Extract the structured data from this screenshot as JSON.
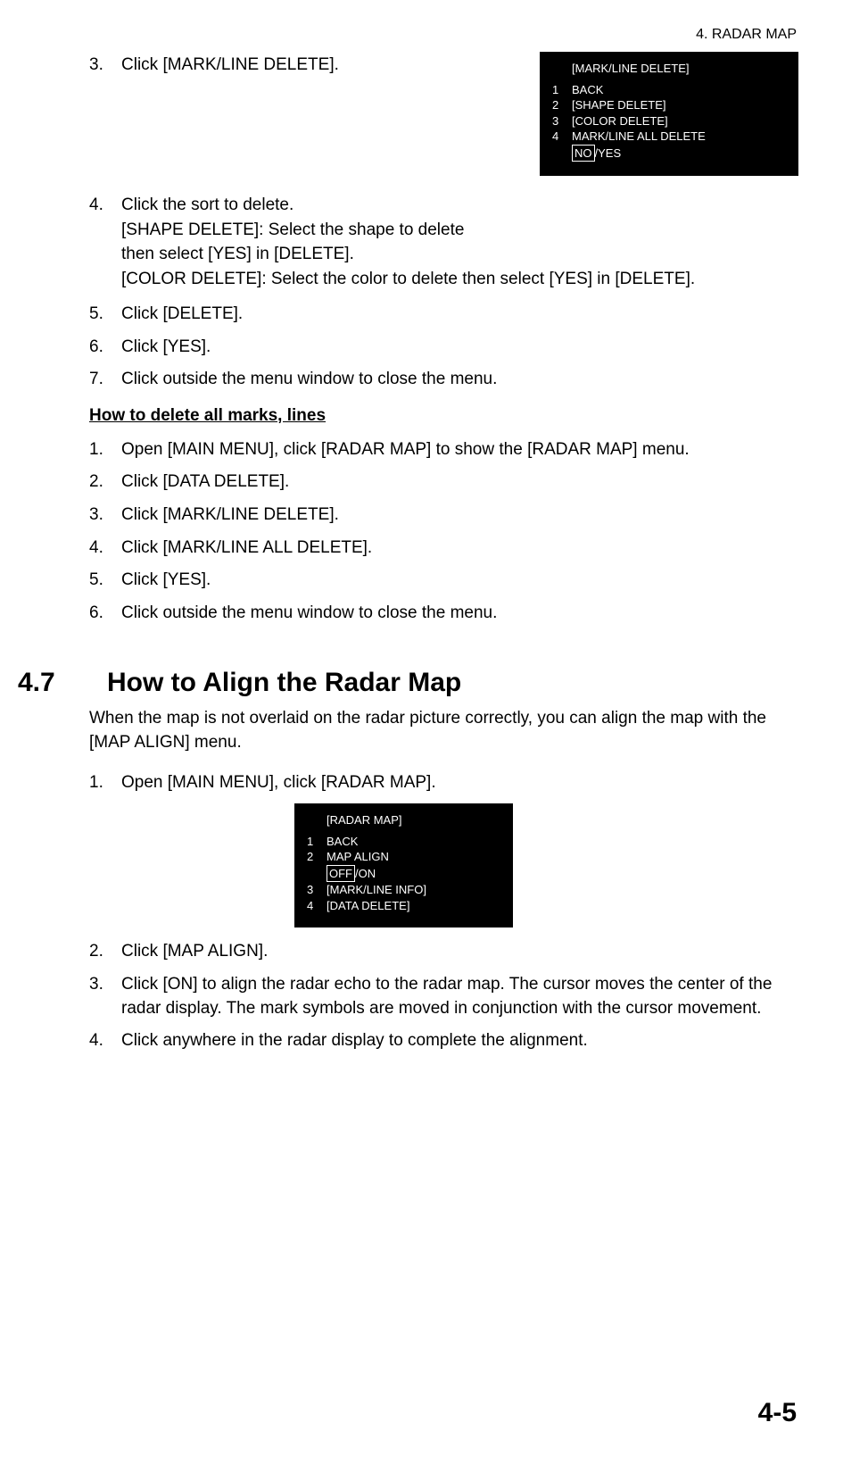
{
  "header": {
    "right": "4.  RADAR MAP"
  },
  "topSteps": {
    "s3": {
      "num": "3.",
      "text": "Click [MARK/LINE DELETE]."
    },
    "s4": {
      "num": "4.",
      "line1": "Click the sort to delete.",
      "line2": "[SHAPE DELETE]: Select the shape to delete then select [YES] in [DELETE].",
      "line3": "[COLOR DELETE]: Select the color to delete then select [YES] in [DELETE]."
    },
    "s5": {
      "num": "5.",
      "text": "Click [DELETE]."
    },
    "s6": {
      "num": "6.",
      "text": "Click [YES]."
    },
    "s7": {
      "num": "7.",
      "text": "Click outside the menu window to close the menu."
    }
  },
  "menu1": {
    "title": "[MARK/LINE DELETE]",
    "r1": {
      "n": "1",
      "t": "BACK"
    },
    "r2": {
      "n": "2",
      "t": "[SHAPE DELETE]"
    },
    "r3": {
      "n": "3",
      "t": "[COLOR DELETE]"
    },
    "r4": {
      "n": "4",
      "t": "MARK/LINE ALL DELETE"
    },
    "sub": {
      "boxed": "NO",
      "rest": "/YES"
    }
  },
  "subheading": "How to delete all marks, lines",
  "deleteAllSteps": {
    "s1": {
      "num": "1.",
      "text": "Open [MAIN MENU], click [RADAR MAP] to show the [RADAR MAP] menu."
    },
    "s2": {
      "num": "2.",
      "text": "Click [DATA DELETE]."
    },
    "s3": {
      "num": "3.",
      "text": "Click [MARK/LINE DELETE]."
    },
    "s4": {
      "num": "4.",
      "text": "Click [MARK/LINE ALL DELETE]."
    },
    "s5": {
      "num": "5.",
      "text": "Click [YES]."
    },
    "s6": {
      "num": "6.",
      "text": "Click outside the menu window to close the menu."
    }
  },
  "section47": {
    "num": "4.7",
    "title": "How to Align the Radar Map",
    "intro": "When the map is not overlaid on the radar picture correctly, you can align the map with the [MAP ALIGN] menu.",
    "s1": {
      "num": "1.",
      "text": "Open [MAIN MENU], click [RADAR MAP]."
    },
    "s2": {
      "num": "2.",
      "text": "Click [MAP ALIGN]."
    },
    "s3": {
      "num": "3.",
      "text": "Click [ON] to align the radar echo to the radar map. The cursor moves the center of the radar display. The mark symbols are moved in conjunction with the cursor movement."
    },
    "s4": {
      "num": "4.",
      "text": "Click anywhere in the radar display to complete the alignment."
    }
  },
  "menu2": {
    "title": "[RADAR MAP]",
    "r1": {
      "n": "1",
      "t": "BACK"
    },
    "r2": {
      "n": "2",
      "t": "MAP ALIGN"
    },
    "sub": {
      "boxed": "OFF",
      "rest": "/ON"
    },
    "r3": {
      "n": "3",
      "t": "[MARK/LINE INFO]"
    },
    "r4": {
      "n": "4",
      "t": "[DATA DELETE]"
    }
  },
  "pageNum": "4-5"
}
